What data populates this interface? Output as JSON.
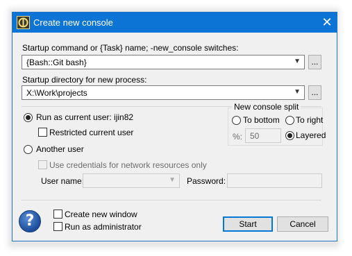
{
  "window": {
    "title": "Create new console",
    "close_symbol": "✕"
  },
  "startup": {
    "label": "Startup command or {Task} name; -new_console switches:",
    "value": "{Bash::Git bash}",
    "browse_label": "..."
  },
  "directory": {
    "label": "Startup directory for new process:",
    "value": "X:\\Work\\projects",
    "browse_label": "..."
  },
  "user": {
    "run_as_current_label": "Run as current user: ijin82",
    "restricted_label": "Restricted current user",
    "another_user_label": "Another user",
    "credentials_label": "Use credentials for network resources only",
    "username_label": "User name:",
    "password_label": "Password:",
    "username_value": "",
    "password_value": ""
  },
  "split": {
    "title": "New console split",
    "to_bottom": "To bottom",
    "to_right": "To right",
    "percent_label": "%:",
    "percent_value": "50",
    "layered": "Layered",
    "selected": "layered"
  },
  "bottom": {
    "create_new_window": "Create new window",
    "run_as_admin": "Run as administrator",
    "start": "Start",
    "cancel": "Cancel",
    "help_symbol": "?"
  },
  "colors": {
    "titlebar": "#0c74d4",
    "accent": "#0078d7"
  }
}
